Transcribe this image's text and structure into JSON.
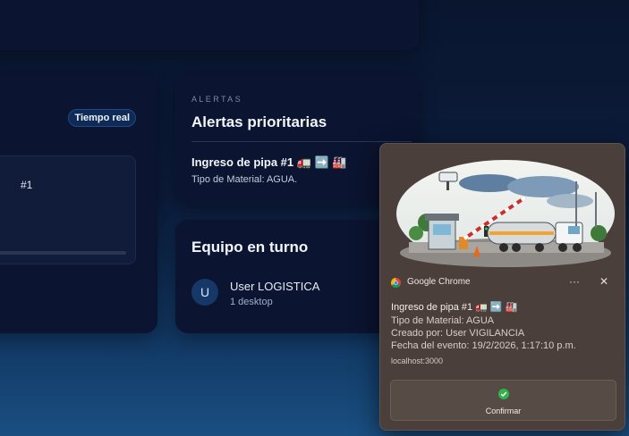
{
  "left_panel": {
    "badge": "Tiempo real",
    "item_label": "#1"
  },
  "alerts": {
    "eyebrow": "ALERTAS",
    "title": "Alertas prioritarias",
    "item_title": "Ingreso de pipa #1 🚛 ➡️ 🏭",
    "item_detail": "Tipo de Material: AGUA."
  },
  "team": {
    "title": "Equipo en turno",
    "user_initial": "U",
    "user_name": "User LOGISTICA",
    "user_devices": "1 desktop"
  },
  "notification": {
    "app_name": "Google Chrome",
    "more_symbol": "···",
    "close_symbol": "✕",
    "title": "Ingreso de pipa #1 🚛 ➡️ 🏭",
    "material": "Tipo de Material: AGUA",
    "created_by": "Creado por: User VIGILANCIA",
    "event_date": "Fecha del evento: 19/2/2026, 1:17:10 p.m.",
    "source": "localhost:3000",
    "confirm_label": "Confirmar",
    "colors": {
      "accent_ok": "#2fb34a",
      "toast_bg": "#4a3f3b"
    }
  }
}
